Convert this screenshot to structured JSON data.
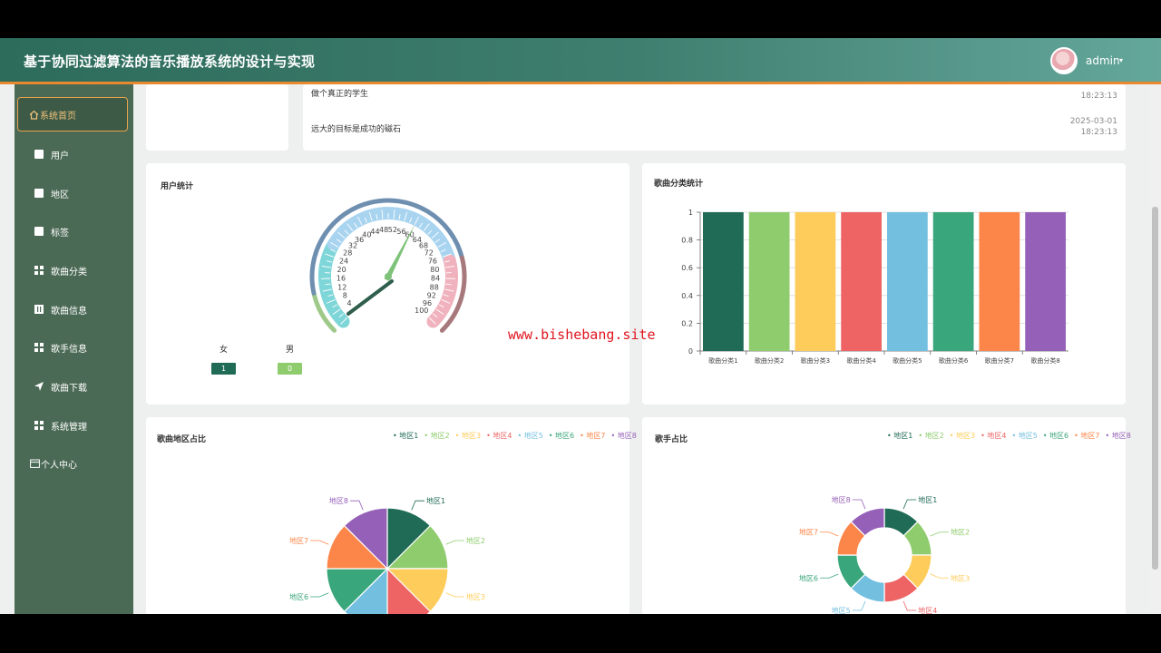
{
  "header": {
    "title": "基于协同过滤算法的音乐播放系统的设计与实现",
    "user": "admin",
    "caret": "▾"
  },
  "sidebar": {
    "items": [
      {
        "label": "系统首页",
        "icon": "home-icon"
      },
      {
        "label": "用户",
        "icon": "square-icon"
      },
      {
        "label": "地区",
        "icon": "square-icon"
      },
      {
        "label": "标签",
        "icon": "square-icon"
      },
      {
        "label": "歌曲分类",
        "icon": "grid-icon"
      },
      {
        "label": "歌曲信息",
        "icon": "book-icon"
      },
      {
        "label": "歌手信息",
        "icon": "grid-icon"
      },
      {
        "label": "歌曲下载",
        "icon": "send-icon"
      },
      {
        "label": "系统管理",
        "icon": "grid-icon"
      },
      {
        "label": "个人中心",
        "icon": "calendar-icon"
      }
    ]
  },
  "notices": [
    {
      "text": "做个真正的学生",
      "time": "18:23:13"
    },
    {
      "text": "远大的目标是成功的磁石",
      "date": "2025-03-01",
      "time": "18:23:13"
    }
  ],
  "user_stats": {
    "title": "用户统计",
    "gauge_ticks": [
      "4",
      "8",
      "12",
      "16",
      "20",
      "24",
      "28",
      "32",
      "36",
      "40",
      "44",
      "48",
      "52",
      "56",
      "60",
      "64",
      "68",
      "72",
      "76",
      "80",
      "84",
      "88",
      "92",
      "96",
      "100"
    ],
    "gauge_value": 60,
    "female_label": "女",
    "female_value": "1",
    "male_label": "男",
    "male_value": "0"
  },
  "colors": [
    "#1f6b55",
    "#8fcc6e",
    "#fdcc5a",
    "#ee6465",
    "#73bfe0",
    "#3aa67b",
    "#fc8549",
    "#9560b8"
  ],
  "region_legend": [
    "地区1",
    "地区2",
    "地区3",
    "地区4",
    "地区5",
    "地区6",
    "地区7",
    "地区8"
  ],
  "category_chart": {
    "title": "歌曲分类统计",
    "chart_data": {
      "type": "bar",
      "categories": [
        "歌曲分类1",
        "歌曲分类2",
        "歌曲分类3",
        "歌曲分类4",
        "歌曲分类5",
        "歌曲分类6",
        "歌曲分类7",
        "歌曲分类8"
      ],
      "values": [
        1,
        1,
        1,
        1,
        1,
        1,
        1,
        1
      ],
      "ylim": [
        0,
        1
      ],
      "yticks": [
        "0",
        "0.2",
        "0.4",
        "0.6",
        "0.8",
        "1"
      ],
      "grid": true
    }
  },
  "region_pie": {
    "title": "歌曲地区占比",
    "chart_data": {
      "type": "pie",
      "labels": [
        "地区1",
        "地区2",
        "地区3",
        "地区4",
        "地区5",
        "地区6",
        "地区7",
        "地区8"
      ],
      "values": [
        1,
        1,
        1,
        1,
        1,
        1,
        1,
        1
      ],
      "legend": "top-right"
    }
  },
  "singer_pie": {
    "title": "歌手占比",
    "chart_data": {
      "type": "pie",
      "labels": [
        "地区1",
        "地区2",
        "地区3",
        "地区4",
        "地区5",
        "地区6",
        "地区7",
        "地区8"
      ],
      "values": [
        1,
        1,
        1,
        1,
        1,
        1,
        1,
        1
      ],
      "legend": "top-right"
    }
  },
  "watermark": "www.bishebang.site"
}
